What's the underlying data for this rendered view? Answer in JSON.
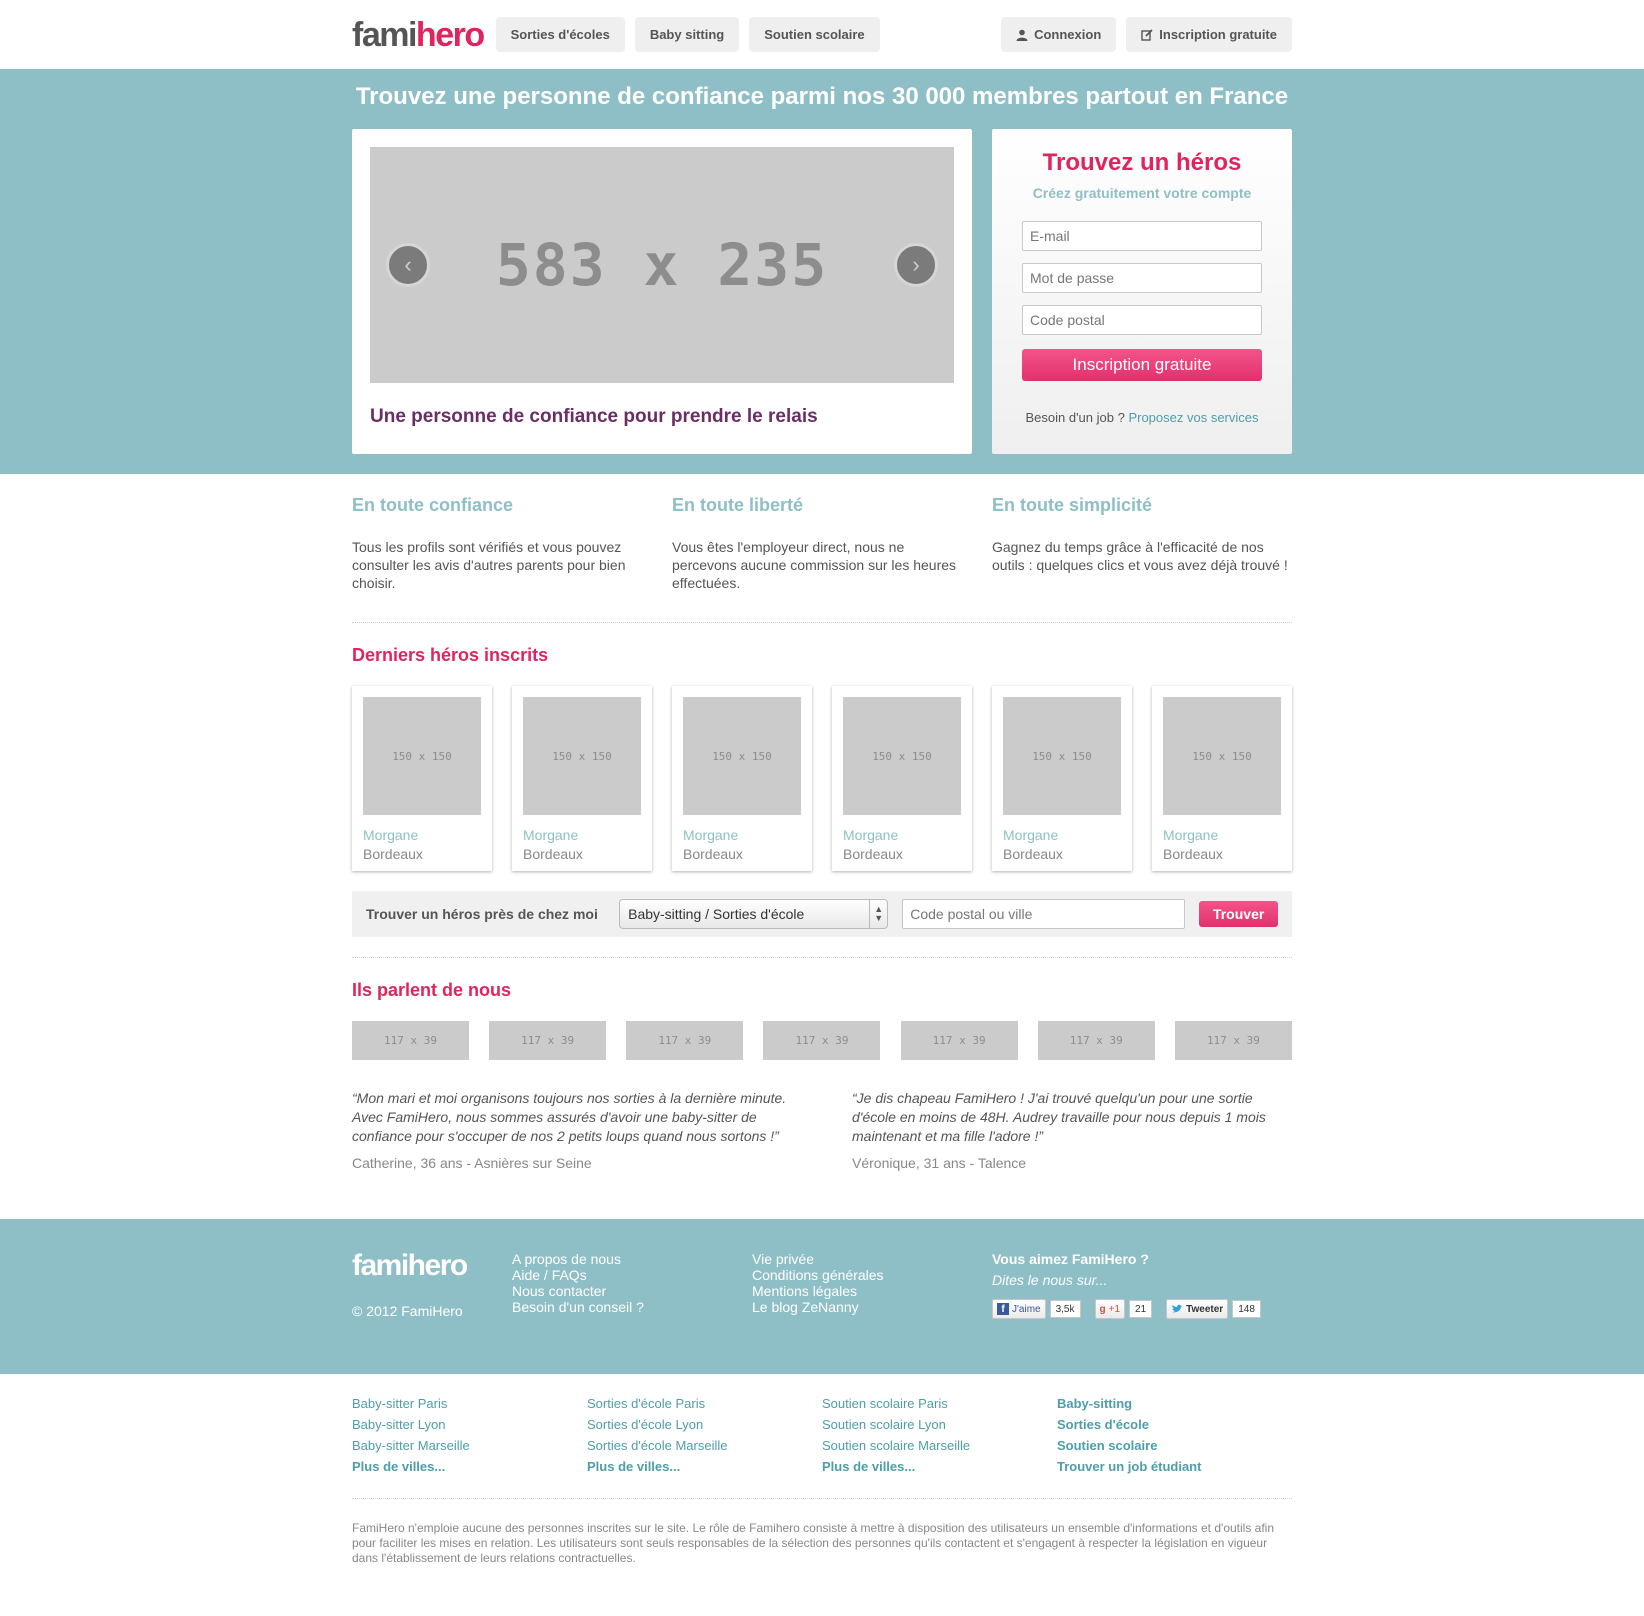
{
  "header": {
    "logo_part1": "fami",
    "logo_part2": "hero",
    "nav": [
      "Sorties d'écoles",
      "Baby sitting",
      "Soutien scolaire"
    ],
    "login": "Connexion",
    "register": "Inscription gratuite"
  },
  "hero": {
    "title": "Trouvez une personne de confiance parmi nos 30 000 membres partout en France",
    "slide_placeholder": "583 x 235",
    "slide_caption": "Une personne de confiance pour prendre le relais",
    "prev_icon": "chevron-left-icon",
    "next_icon": "chevron-right-icon"
  },
  "signup": {
    "title": "Trouvez un héros",
    "subtitle": "Créez gratuitement votre compte",
    "email_placeholder": "E-mail",
    "password_placeholder": "Mot de passe",
    "postal_placeholder": "Code postal",
    "submit": "Inscription gratuite",
    "job_text": "Besoin d'un job ?",
    "job_link": "Proposez vos services"
  },
  "features": [
    {
      "title": "En toute confiance",
      "text": "Tous les profils sont vérifiés et vous pouvez consulter les avis d'autres parents pour bien choisir."
    },
    {
      "title": "En toute liberté",
      "text": "Vous êtes l'employeur direct, nous ne percevons aucune commission sur les heures effectuées."
    },
    {
      "title": "En toute simplicité",
      "text": "Gagnez du temps grâce à l'efficacité de nos outils : quelques clics et vous avez déjà trouvé !"
    }
  ],
  "latest": {
    "title": "Derniers héros inscrits",
    "photo_placeholder": "150 x 150",
    "items": [
      {
        "name": "Morgane",
        "city": "Bordeaux"
      },
      {
        "name": "Morgane",
        "city": "Bordeaux"
      },
      {
        "name": "Morgane",
        "city": "Bordeaux"
      },
      {
        "name": "Morgane",
        "city": "Bordeaux"
      },
      {
        "name": "Morgane",
        "city": "Bordeaux"
      },
      {
        "name": "Morgane",
        "city": "Bordeaux"
      }
    ]
  },
  "search": {
    "label": "Trouver un héros près de chez moi",
    "select_value": "Baby-sitting / Sorties d'école",
    "input_placeholder": "Code postal ou ville",
    "button": "Trouver"
  },
  "press": {
    "title": "Ils parlent de nous",
    "logo_placeholder": "117 x 39",
    "count": 7
  },
  "testimonials": [
    {
      "quote": "“Mon mari et moi organisons toujours nos sorties à la dernière minute. Avec FamiHero, nous sommes assurés d'avoir une baby-sitter de confiance pour s'occuper de nos 2 petits loups quand nous sortons !”",
      "author": "Catherine, 36 ans - Asnières sur Seine"
    },
    {
      "quote": "“Je dis chapeau FamiHero ! J'ai trouvé quelqu'un pour une sortie d'école en moins de 48H. Audrey travaille pour nous depuis 1 mois maintenant et ma fille l'adore !”",
      "author": "Véronique, 31 ans - Talence"
    }
  ],
  "footer": {
    "logo": "famihero",
    "copyright": "© 2012 FamiHero",
    "col1": [
      "A propos de nous",
      "Aide / FAQs",
      "Nous contacter",
      "Besoin d'un conseil ?"
    ],
    "col2": [
      "Vie privée",
      "Conditions générales",
      "Mentions légales",
      "Le blog ZeNanny"
    ],
    "social_title": "Vous aimez FamiHero ?",
    "social_sub": "Dites le nous sur...",
    "facebook_label": "J'aime",
    "facebook_count": "3,5k",
    "gplus_label": "+1",
    "gplus_count": "21",
    "twitter_label": "Tweeter",
    "twitter_count": "148"
  },
  "city_links": [
    {
      "items": [
        "Baby-sitter Paris",
        "Baby-sitter Lyon",
        "Baby-sitter Marseille"
      ],
      "more": "Plus de villes..."
    },
    {
      "items": [
        "Sorties d'école Paris",
        "Sorties d'école Lyon",
        "Sorties d'école Marseille"
      ],
      "more": "Plus de villes..."
    },
    {
      "items": [
        "Soutien scolaire Paris",
        "Soutien scolaire Lyon",
        "Soutien scolaire Marseille"
      ],
      "more": "Plus de villes..."
    },
    {
      "items": [],
      "bold_items": [
        "Baby-sitting",
        "Sorties d'école",
        "Soutien scolaire",
        "Trouver un job étudiant"
      ]
    }
  ],
  "disclaimer": "FamiHero n'emploie aucune des personnes inscrites sur le site. Le rôle de Famihero consiste à mettre à disposition des utilisateurs un ensemble d'informations et d'outils afin pour faciliter les mises en relation. Les utilisateurs sont seuls responsables de la sélection des personnes qu'ils contactent et s'engagent à respecter la législation en vigueur dans l'établissement de leurs relations contractuelles.",
  "colors": {
    "accent": "#e0245e",
    "teal": "#8ebfc6",
    "purple": "#6b2d66",
    "link": "#4e9eaa"
  }
}
